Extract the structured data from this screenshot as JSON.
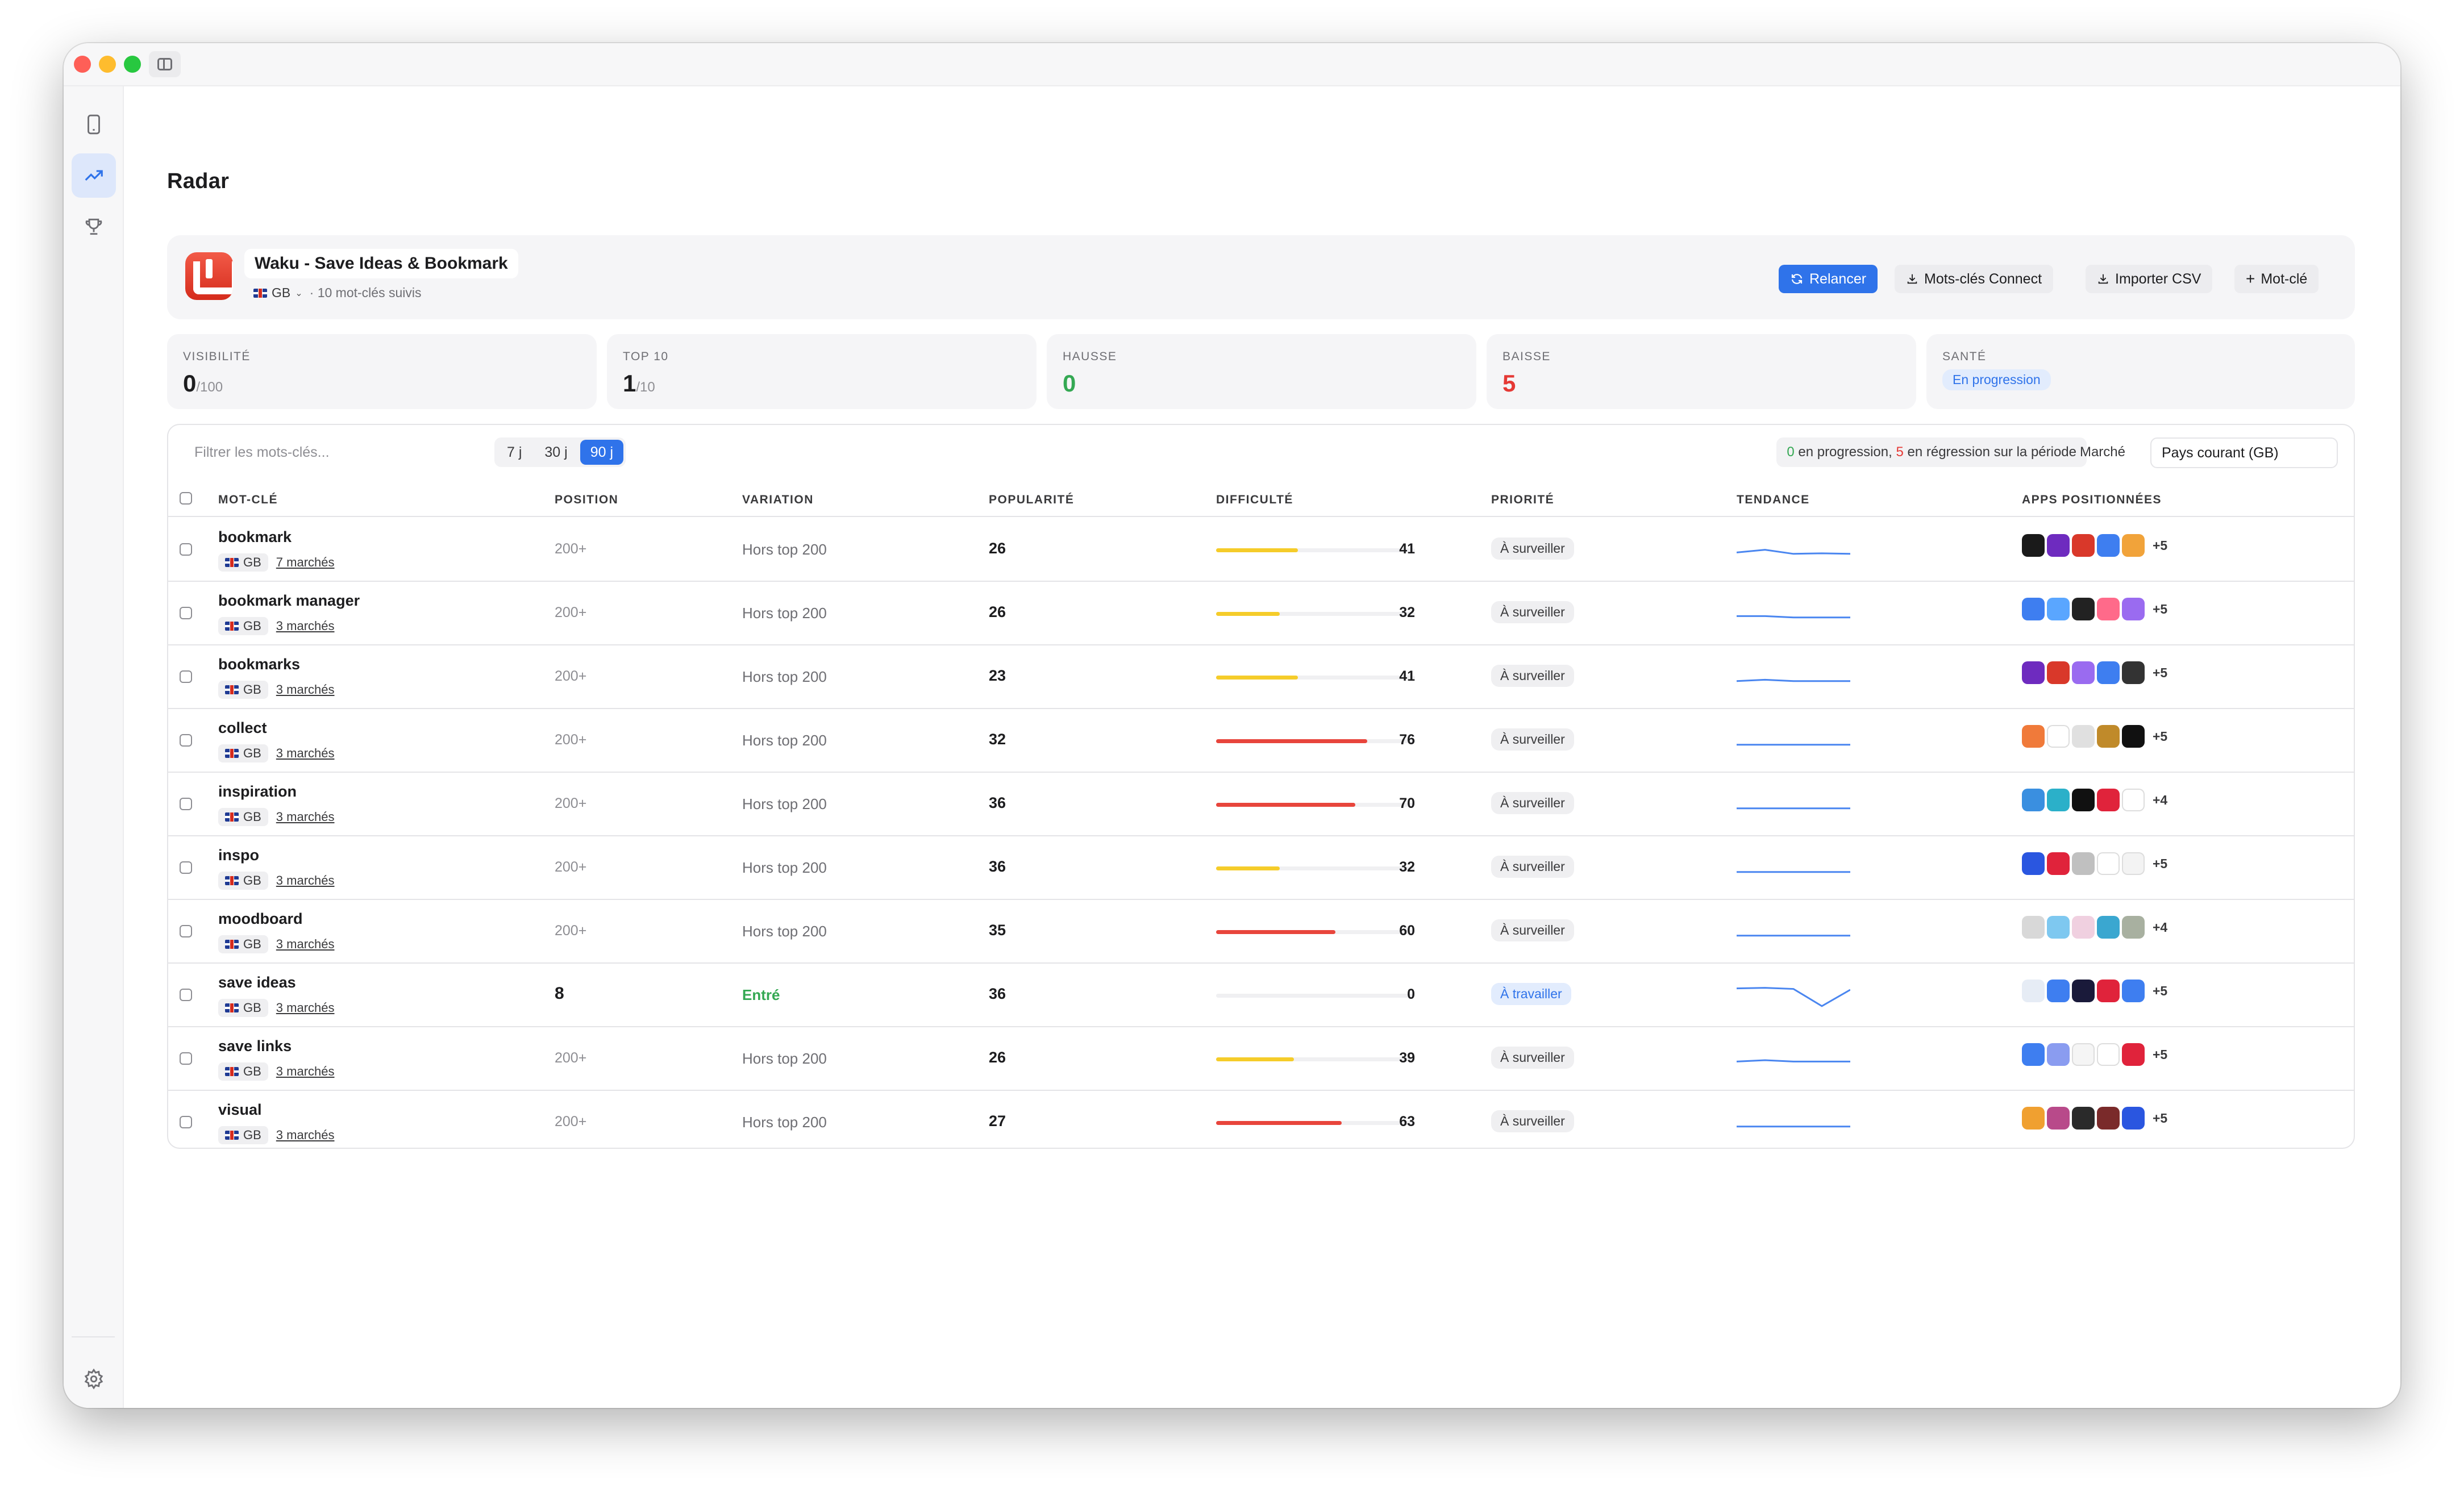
{
  "page_title": "Radar",
  "app": {
    "name": "Waku - Save Ideas & Bookmark",
    "country": "GB",
    "tracked": "· 10 mot-clés suivis"
  },
  "actions": {
    "relaunch": "Relancer",
    "connect": "Mots-clés Connect",
    "import": "Importer CSV",
    "add": "Mot-clé"
  },
  "stats": [
    {
      "label": "VISIBILITÉ",
      "value": "0",
      "suffix": "/100",
      "color": "#1d1d1f"
    },
    {
      "label": "TOP 10",
      "value": "1",
      "suffix": "/10",
      "color": "#1d1d1f"
    },
    {
      "label": "HAUSSE",
      "value": "0",
      "suffix": "",
      "color": "#34a853"
    },
    {
      "label": "BAISSE",
      "value": "5",
      "suffix": "",
      "color": "#e53935"
    },
    {
      "label": "SANTÉ",
      "badge": "En progression"
    }
  ],
  "filter": {
    "placeholder": "Filtrer les mots-clés...",
    "periods": [
      "7 j",
      "30 j",
      "90 j"
    ],
    "active_period": "90 j"
  },
  "summary": {
    "up": "0",
    "up_text": " en progression, ",
    "down": "5",
    "down_text": " en régression sur la période"
  },
  "market": {
    "label": "Marché",
    "value": "Pays courant (GB)"
  },
  "columns": [
    "MOT-CLÉ",
    "POSITION",
    "VARIATION",
    "POPULARITÉ",
    "DIFFICULTÉ",
    "PRIORITÉ",
    "TENDANCE",
    "APPS POSITIONNÉES"
  ],
  "rows": [
    {
      "kw": "bookmark",
      "country": "GB",
      "markets": "7 marchés",
      "pos": "200+",
      "var": "Hors top 200",
      "pop": "26",
      "diff": 41,
      "pri": "À surveiller",
      "more": "+5",
      "trend": [
        0.55,
        0.45,
        0.6,
        0.58,
        0.6
      ],
      "apps": [
        "#1a1a1a",
        "#6e2bbf",
        "#d9382a",
        "#3e7ef0",
        "#f1a33a"
      ]
    },
    {
      "kw": "bookmark manager",
      "country": "GB",
      "markets": "3 marchés",
      "pos": "200+",
      "var": "Hors top 200",
      "pop": "26",
      "diff": 32,
      "pri": "À surveiller",
      "more": "+5",
      "trend": [
        0.55,
        0.55,
        0.6,
        0.6,
        0.6
      ],
      "apps": [
        "#3e7ef0",
        "#5aa6ff",
        "#222222",
        "#ff6a8a",
        "#9a6bf0"
      ]
    },
    {
      "kw": "bookmarks",
      "country": "GB",
      "markets": "3 marchés",
      "pos": "200+",
      "var": "Hors top 200",
      "pop": "23",
      "diff": 41,
      "pri": "À surveiller",
      "more": "+5",
      "trend": [
        0.6,
        0.55,
        0.6,
        0.6,
        0.6
      ],
      "apps": [
        "#6e2bbf",
        "#d9382a",
        "#9a6bf0",
        "#3e7ef0",
        "#333333"
      ]
    },
    {
      "kw": "collect",
      "country": "GB",
      "markets": "3 marchés",
      "pos": "200+",
      "var": "Hors top 200",
      "pop": "32",
      "diff": 76,
      "pri": "À surveiller",
      "more": "+5",
      "trend": [
        0.6,
        0.6,
        0.6,
        0.6,
        0.6
      ],
      "apps": [
        "#f07a3a",
        "#ffffff",
        "#e0e0e0",
        "#c08a2a",
        "#111111"
      ]
    },
    {
      "kw": "inspiration",
      "country": "GB",
      "markets": "3 marchés",
      "pos": "200+",
      "var": "Hors top 200",
      "pop": "36",
      "diff": 70,
      "pri": "À surveiller",
      "more": "+4",
      "trend": [
        0.6,
        0.6,
        0.6,
        0.6,
        0.6
      ],
      "apps": [
        "#3a8fe0",
        "#2bb0c9",
        "#111111",
        "#e0233b",
        "#ffffff"
      ]
    },
    {
      "kw": "inspo",
      "country": "GB",
      "markets": "3 marchés",
      "pos": "200+",
      "var": "Hors top 200",
      "pop": "36",
      "diff": 32,
      "pri": "À surveiller",
      "more": "+5",
      "trend": [
        0.6,
        0.6,
        0.6,
        0.6,
        0.6
      ],
      "apps": [
        "#2a56e0",
        "#e0233b",
        "#c0c0c0",
        "#ffffff",
        "#f3f3f3"
      ]
    },
    {
      "kw": "moodboard",
      "country": "GB",
      "markets": "3 marchés",
      "pos": "200+",
      "var": "Hors top 200",
      "pop": "35",
      "diff": 60,
      "pri": "À surveiller",
      "more": "+4",
      "trend": [
        0.6,
        0.6,
        0.6,
        0.6,
        0.6
      ],
      "apps": [
        "#d8d8d8",
        "#7ec8f0",
        "#f0d0e0",
        "#3aa7d0",
        "#a8b0a0"
      ]
    },
    {
      "kw": "save ideas",
      "country": "GB",
      "markets": "3 marchés",
      "pos": "8",
      "var": "Entré",
      "pop": "36",
      "diff": 0,
      "pri": "À travailler",
      "more": "+5",
      "trend": [
        0.2,
        0.18,
        0.22,
        0.85,
        0.25
      ],
      "apps": [
        "#e6ecf5",
        "#3e7ef0",
        "#1a1a3a",
        "#e0233b",
        "#3e7ef0"
      ]
    },
    {
      "kw": "save links",
      "country": "GB",
      "markets": "3 marchés",
      "pos": "200+",
      "var": "Hors top 200",
      "pop": "26",
      "diff": 39,
      "pri": "À surveiller",
      "more": "+5",
      "trend": [
        0.55,
        0.5,
        0.55,
        0.55,
        0.55
      ],
      "apps": [
        "#3e7ef0",
        "#8a9cf0",
        "#f5f5f5",
        "#ffffff",
        "#e0233b"
      ]
    },
    {
      "kw": "visual",
      "country": "GB",
      "markets": "3 marchés",
      "pos": "200+",
      "var": "Hors top 200",
      "pop": "27",
      "diff": 63,
      "pri": "À surveiller",
      "more": "+5",
      "trend": [
        0.6,
        0.6,
        0.6,
        0.6,
        0.6
      ],
      "apps": [
        "#f0a030",
        "#b84a8a",
        "#2a2a2a",
        "#7a2a2a",
        "#2a56e0"
      ]
    }
  ]
}
